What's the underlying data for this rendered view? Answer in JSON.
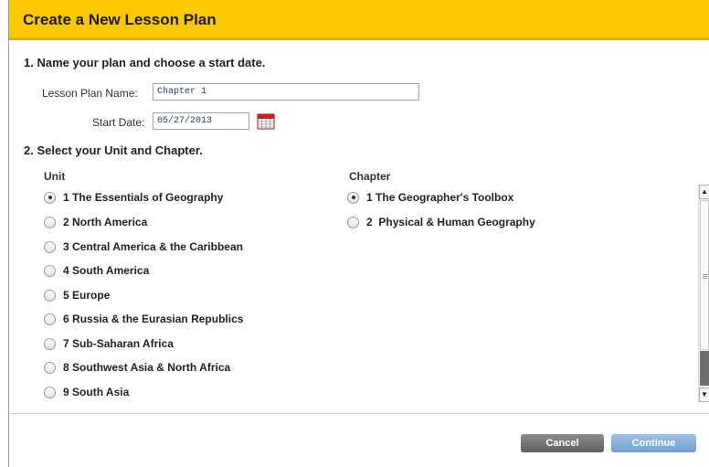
{
  "dialog": {
    "title": "Create a New Lesson Plan",
    "section1": "1. Name your plan and choose a start date.",
    "name_label": "Lesson Plan Name:",
    "name_value": "Chapter 1",
    "date_label": "Start Date:",
    "date_value": "05/27/2013",
    "section2": "2. Select your Unit and Chapter.",
    "unit_header": "Unit",
    "chapter_header": "Chapter",
    "units": [
      {
        "num": "1",
        "label": "The Essentials of Geography",
        "checked": true
      },
      {
        "num": "2",
        "label": "North America",
        "checked": false
      },
      {
        "num": "3",
        "label": "Central America & the Caribbean",
        "checked": false
      },
      {
        "num": "4",
        "label": "South America",
        "checked": false
      },
      {
        "num": "5",
        "label": "Europe",
        "checked": false
      },
      {
        "num": "6",
        "label": "Russia & the Eurasian Republics",
        "checked": false
      },
      {
        "num": "7",
        "label": "Sub-Saharan Africa",
        "checked": false
      },
      {
        "num": "8",
        "label": "Southwest Asia & North Africa",
        "checked": false
      },
      {
        "num": "9",
        "label": "South Asia",
        "checked": false
      }
    ],
    "chapters": [
      {
        "num": "1",
        "label": "The Geographer's Toolbox",
        "checked": true
      },
      {
        "num": "2",
        "label": " Physical & Human Geography",
        "checked": false
      }
    ],
    "cancel_label": "Cancel",
    "continue_label": "Continue"
  },
  "colors": {
    "header": "#fcc800",
    "cancel": "#6f6f6f",
    "continue": "#7aa8d8"
  },
  "icons": {
    "calendar": "calendar-icon"
  }
}
